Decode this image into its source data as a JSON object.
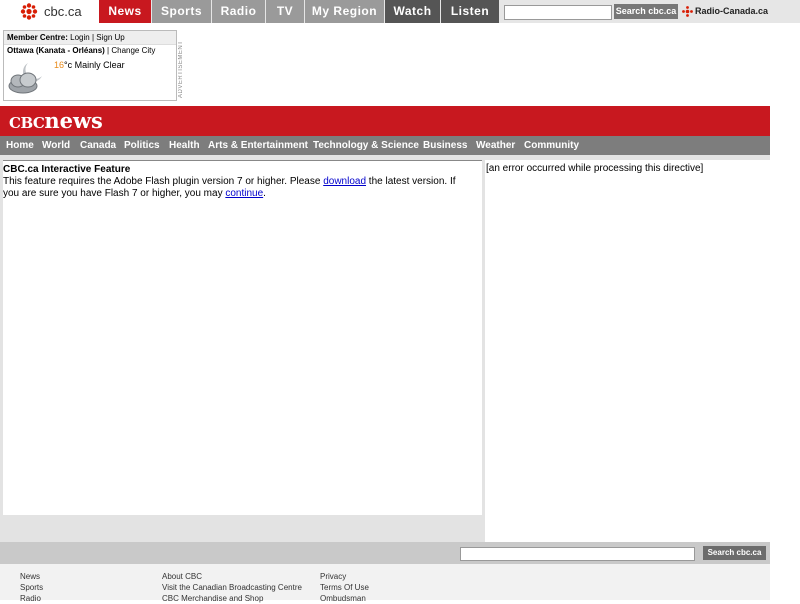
{
  "global_nav": {
    "logo_text": "cbc.ca",
    "tabs": [
      "News",
      "Sports",
      "Radio",
      "TV",
      "My Region",
      "Watch",
      "Listen"
    ],
    "search_button": "Search cbc.ca",
    "partner_link": "Radio-Canada.ca"
  },
  "member_box": {
    "label": "Member Centre:",
    "login": "Login",
    "separator": "|",
    "signup": "Sign Up",
    "city": "Ottawa (Kanata - Orléans)",
    "change_city": "Change City",
    "temp": "16",
    "unit": "°c",
    "condition": "Mainly Clear",
    "weather_icon": "cloud-moon-icon",
    "ad_label": "ADVERTISEMENT"
  },
  "banner": {
    "logo_cbc": "CBC",
    "logo_news": "news"
  },
  "section_nav": [
    "Home",
    "World",
    "Canada",
    "Politics",
    "Health",
    "Arts & Entertainment",
    "Technology & Science",
    "Business",
    "Weather",
    "Community"
  ],
  "feature": {
    "title": "CBC.ca Interactive Feature",
    "text_1": "This feature requires the Adobe Flash plugin version 7 or higher. Please ",
    "link_1": "download",
    "text_2": " the latest version. If you are sure you have Flash 7 or higher, you may ",
    "link_2": "continue",
    "text_3": "."
  },
  "error_text": "[an error occurred while processing this directive]",
  "footer": {
    "search_button": "Search cbc.ca",
    "col1": [
      "News",
      "Sports",
      "Radio"
    ],
    "col2": [
      "About CBC",
      "Visit the Canadian Broadcasting Centre",
      "CBC Merchandise and Shop"
    ],
    "col3": [
      "Privacy",
      "Terms Of Use",
      "Ombudsman"
    ]
  },
  "colors": {
    "brand_red": "#c8181f",
    "active_tab": "#c8181f",
    "tab_gray": "#999999",
    "tab_dark": "#555555"
  }
}
